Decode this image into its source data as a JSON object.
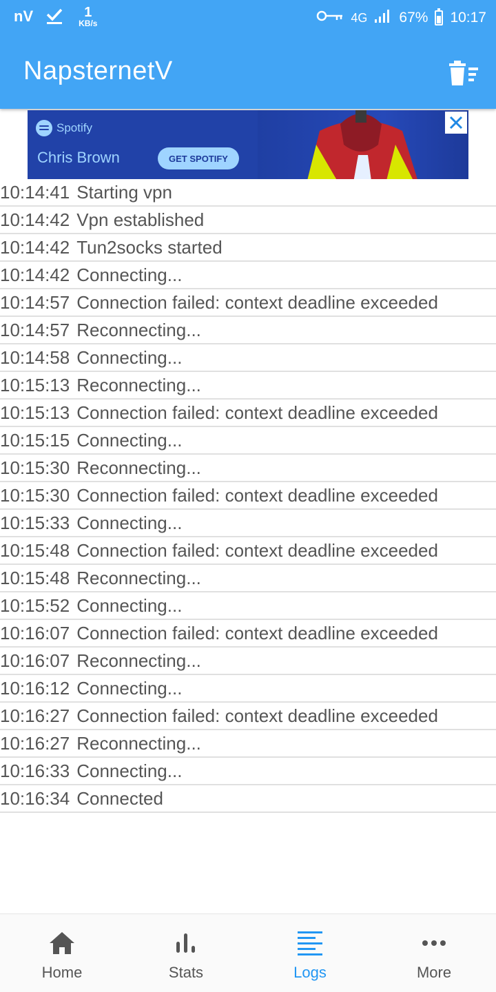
{
  "status_bar": {
    "app_badge": "nV",
    "speed_value": "1",
    "speed_unit": "KB/s",
    "network": "4G",
    "battery": "67%",
    "time": "10:17"
  },
  "app_bar": {
    "title": "NapsternetV",
    "action_icon": "delete-sweep-icon"
  },
  "ad": {
    "brand": "Spotify",
    "artist": "Chris Brown",
    "cta": "GET SPOTIFY",
    "close_icon": "close-icon"
  },
  "logs": [
    {
      "time": "10:14:41",
      "message": "Starting vpn"
    },
    {
      "time": "10:14:42",
      "message": "Vpn established"
    },
    {
      "time": "10:14:42",
      "message": "Tun2socks started"
    },
    {
      "time": "10:14:42",
      "message": "Connecting..."
    },
    {
      "time": "10:14:57",
      "message": "Connection failed: context deadline exceeded"
    },
    {
      "time": "10:14:57",
      "message": "Reconnecting..."
    },
    {
      "time": "10:14:58",
      "message": "Connecting..."
    },
    {
      "time": "10:15:13",
      "message": "Reconnecting..."
    },
    {
      "time": "10:15:13",
      "message": "Connection failed: context deadline exceeded"
    },
    {
      "time": "10:15:15",
      "message": "Connecting..."
    },
    {
      "time": "10:15:30",
      "message": "Reconnecting..."
    },
    {
      "time": "10:15:30",
      "message": "Connection failed: context deadline exceeded"
    },
    {
      "time": "10:15:33",
      "message": "Connecting..."
    },
    {
      "time": "10:15:48",
      "message": "Connection failed: context deadline exceeded"
    },
    {
      "time": "10:15:48",
      "message": "Reconnecting..."
    },
    {
      "time": "10:15:52",
      "message": "Connecting..."
    },
    {
      "time": "10:16:07",
      "message": "Connection failed: context deadline exceeded"
    },
    {
      "time": "10:16:07",
      "message": "Reconnecting..."
    },
    {
      "time": "10:16:12",
      "message": "Connecting..."
    },
    {
      "time": "10:16:27",
      "message": "Connection failed: context deadline exceeded"
    },
    {
      "time": "10:16:27",
      "message": "Reconnecting..."
    },
    {
      "time": "10:16:33",
      "message": "Connecting..."
    },
    {
      "time": "10:16:34",
      "message": "Connected"
    }
  ],
  "bottom_nav": {
    "active": "Logs",
    "items": [
      {
        "label": "Home",
        "icon": "home-icon"
      },
      {
        "label": "Stats",
        "icon": "stats-icon"
      },
      {
        "label": "Logs",
        "icon": "logs-icon"
      },
      {
        "label": "More",
        "icon": "more-icon"
      }
    ]
  },
  "colors": {
    "primary": "#42a5f5",
    "active_tab": "#2196f3",
    "text": "#555555"
  }
}
